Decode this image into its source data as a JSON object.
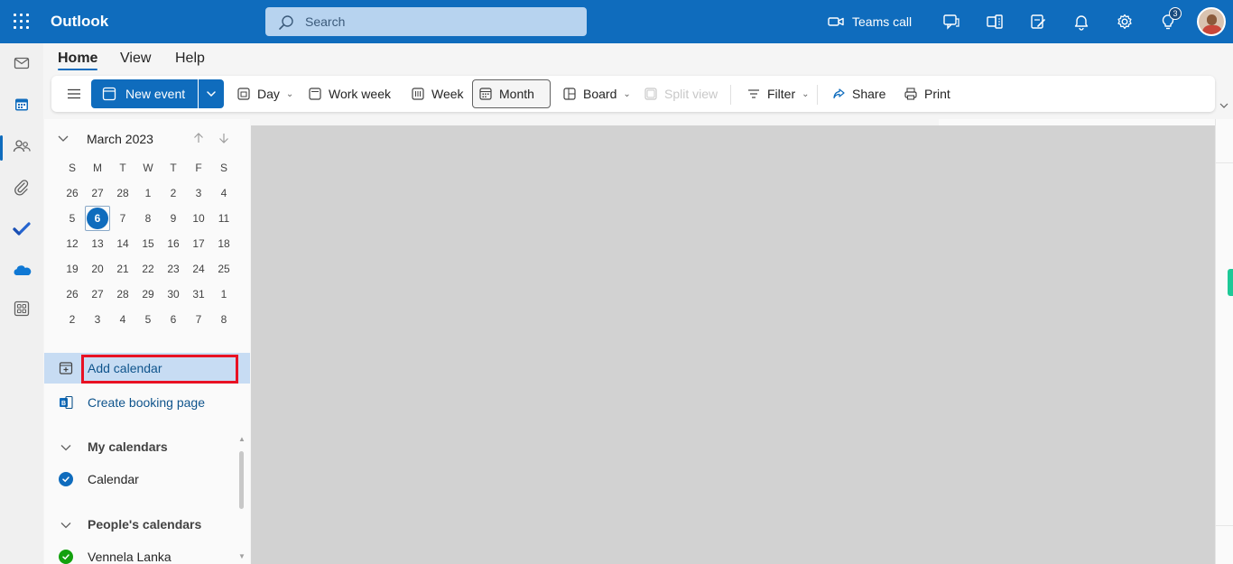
{
  "app": {
    "title": "Outlook",
    "brand_color": "#0f6cbd"
  },
  "search": {
    "placeholder": "Search"
  },
  "header": {
    "teams_call_label": "Teams call",
    "notification_badge": "3",
    "icons": [
      "teams-chat-icon",
      "office-apps-icon",
      "my-day-icon",
      "bell-icon",
      "gear-icon",
      "lightbulb-icon"
    ]
  },
  "rail": {
    "items": [
      "mail-icon",
      "calendar-icon",
      "people-icon",
      "attachment-icon",
      "todo-icon",
      "onedrive-icon",
      "apps-icon"
    ],
    "active": "calendar-icon"
  },
  "ribbon": {
    "tabs": [
      {
        "label": "Home",
        "active": true
      },
      {
        "label": "View",
        "active": false
      },
      {
        "label": "Help",
        "active": false
      }
    ],
    "new_event": "New event",
    "day": "Day",
    "work_week": "Work week",
    "week": "Week",
    "month": "Month",
    "board": "Board",
    "split_view": "Split view",
    "filter": "Filter",
    "share": "Share",
    "print": "Print",
    "selected_view": "Month"
  },
  "mini_calendar": {
    "title": "March 2023",
    "weekdays": [
      "S",
      "M",
      "T",
      "W",
      "T",
      "F",
      "S"
    ],
    "weeks": [
      [
        "26",
        "27",
        "28",
        "1",
        "2",
        "3",
        "4"
      ],
      [
        "5",
        "6",
        "7",
        "8",
        "9",
        "10",
        "11"
      ],
      [
        "12",
        "13",
        "14",
        "15",
        "16",
        "17",
        "18"
      ],
      [
        "19",
        "20",
        "21",
        "22",
        "23",
        "24",
        "25"
      ],
      [
        "26",
        "27",
        "28",
        "29",
        "30",
        "31",
        "1"
      ],
      [
        "2",
        "3",
        "4",
        "5",
        "6",
        "7",
        "8"
      ]
    ],
    "today": "6"
  },
  "nav": {
    "add_calendar": "Add calendar",
    "create_booking_page": "Create booking page"
  },
  "groups": {
    "my_calendars": {
      "title": "My calendars",
      "items": [
        {
          "label": "Calendar",
          "color": "#0f6cbd",
          "checked": true
        }
      ]
    },
    "peoples_calendars": {
      "title": "People's calendars",
      "items": [
        {
          "label": "Vennela Lanka",
          "color": "#13a10e",
          "checked": true
        }
      ]
    }
  }
}
